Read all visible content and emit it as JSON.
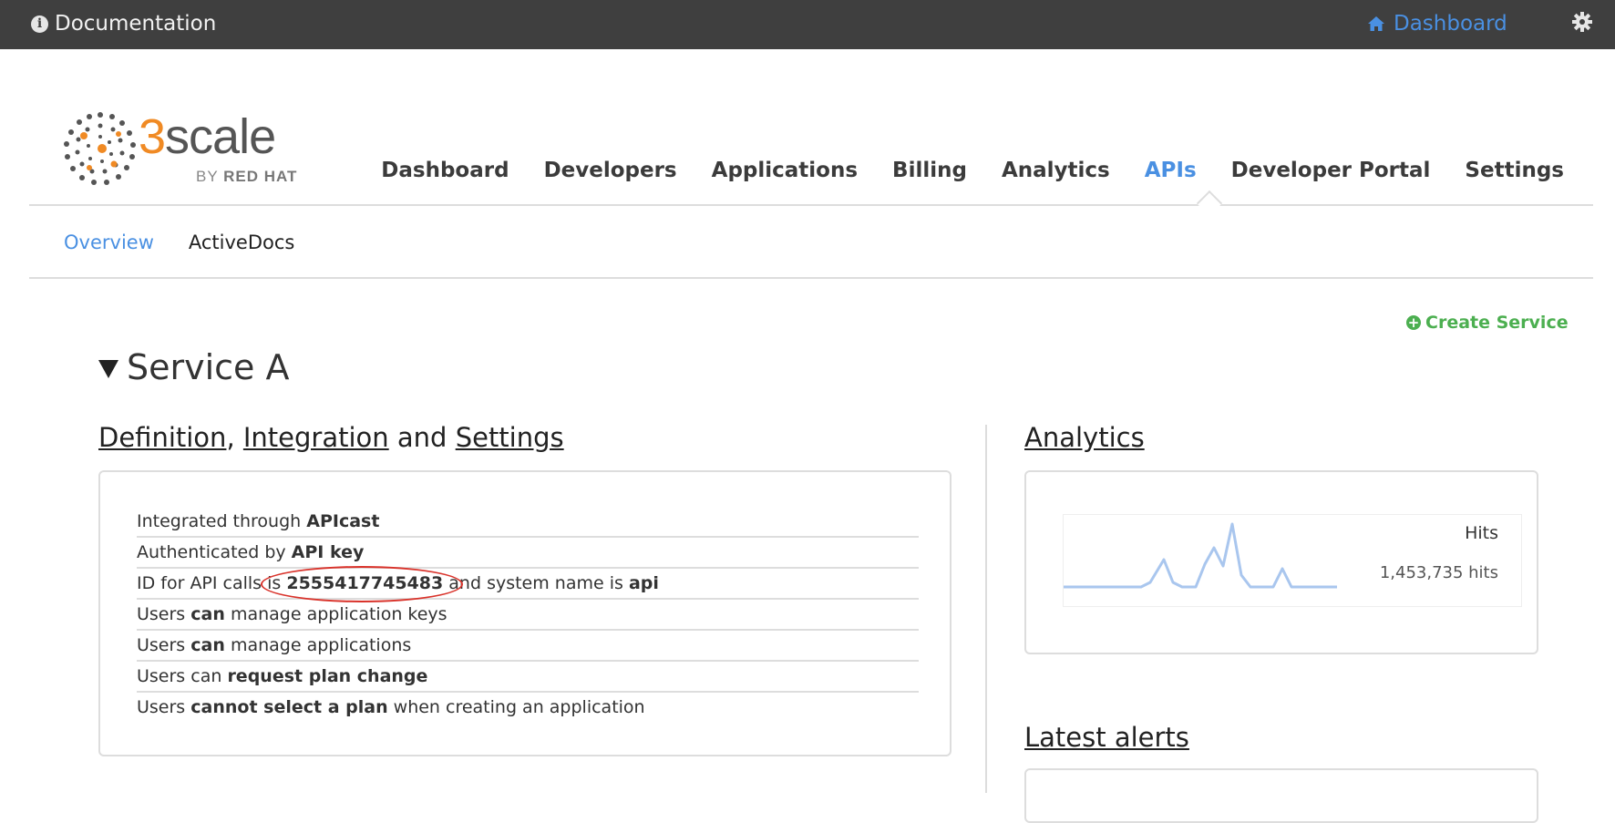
{
  "topbar": {
    "documentation": "Documentation",
    "dashboard": "Dashboard"
  },
  "logo": {
    "brand_number": "3",
    "brand_word": "scale",
    "by": "BY",
    "red_hat": "RED HAT"
  },
  "main_nav": {
    "items": [
      {
        "label": "Dashboard"
      },
      {
        "label": "Developers"
      },
      {
        "label": "Applications"
      },
      {
        "label": "Billing"
      },
      {
        "label": "Analytics"
      },
      {
        "label": "APIs",
        "active": true
      },
      {
        "label": "Developer Portal"
      },
      {
        "label": "Settings"
      }
    ]
  },
  "sub_nav": {
    "items": [
      {
        "label": "Overview",
        "active": true
      },
      {
        "label": "ActiveDocs"
      }
    ]
  },
  "create_service": "Create Service",
  "service": {
    "title": "Service A",
    "definition_section": {
      "link_definition": "Definition",
      "comma": ",",
      "link_integration": "Integration",
      "and": "and",
      "link_settings": "Settings"
    },
    "details": {
      "integrated_prefix": "Integrated through",
      "integrated_value": "APIcast",
      "auth_prefix": "Authenticated by",
      "auth_value": "API key",
      "id_prefix": "ID for API calls is",
      "id_value": "2555417745483",
      "id_middle": "and system name is",
      "system_name": "api",
      "keys_prefix": "Users",
      "keys_bold": "can",
      "keys_suffix": "manage application keys",
      "apps_prefix": "Users",
      "apps_bold": "can",
      "apps_suffix": "manage applications",
      "plan_prefix": "Users can",
      "plan_bold": "request plan change",
      "select_prefix": "Users",
      "select_bold": "cannot select a plan",
      "select_suffix": "when creating an application"
    },
    "analytics": {
      "title": "Analytics",
      "metric": "Hits",
      "total": "1,453,735 hits",
      "line_color": "#a9c6ee"
    },
    "latest_alerts": {
      "title": "Latest alerts"
    }
  },
  "colors": {
    "topbar_bg": "#3f3f3f",
    "accent_blue": "#4a90e2",
    "create_green": "#4caf50",
    "brand_orange": "#f08a24",
    "highlight_red": "#d9322a"
  }
}
